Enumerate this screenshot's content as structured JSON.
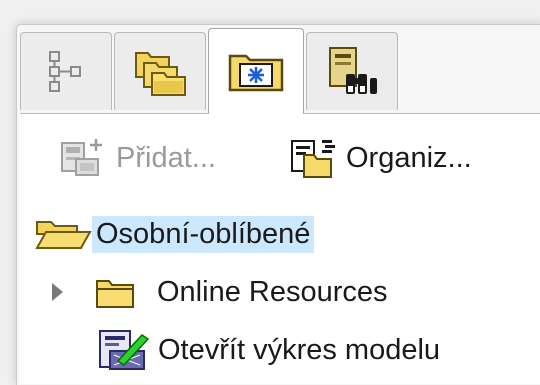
{
  "tabs": [
    {
      "name": "tree-icon",
      "active": false
    },
    {
      "name": "folder-stack-icon",
      "active": false
    },
    {
      "name": "favorites-folder-icon",
      "active": true
    },
    {
      "name": "search-binoculars-icon",
      "active": false
    }
  ],
  "toolbar": {
    "add_label": "Přidat...",
    "organize_label": "Organiz..."
  },
  "tree": {
    "root_label": "Osobní-oblíbené",
    "items": [
      {
        "label": "Online Resources",
        "icon": "folder-icon",
        "expandable": true
      },
      {
        "label": "Otevřít výkres modelu",
        "icon": "drawing-icon",
        "expandable": false
      }
    ]
  },
  "colors": {
    "selection": "#cce8ff",
    "folder": "#f6d96b",
    "accent_blue": "#1a5fd6"
  }
}
